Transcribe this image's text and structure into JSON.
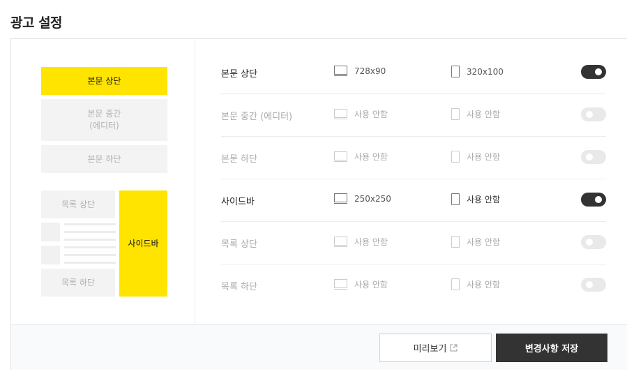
{
  "page": {
    "title": "광고 설정"
  },
  "preview": {
    "body_top": "본문 상단",
    "body_middle": "본문 중간\n(에디터)",
    "body_bottom": "본문 하단",
    "list_top": "목록 상단",
    "list_bottom": "목록 하단",
    "sidebar": "사이드바"
  },
  "rows": [
    {
      "label": "본문 상단",
      "pc": "728x90",
      "mobile": "320x100",
      "enabled": true
    },
    {
      "label": "본문 중간 (에디터)",
      "pc": "사용 안함",
      "mobile": "사용 안함",
      "enabled": false
    },
    {
      "label": "본문 하단",
      "pc": "사용 안함",
      "mobile": "사용 안함",
      "enabled": false
    },
    {
      "label": "사이드바",
      "pc": "250x250",
      "mobile": "사용 안함",
      "enabled": true
    },
    {
      "label": "목록 상단",
      "pc": "사용 안함",
      "mobile": "사용 안함",
      "enabled": false
    },
    {
      "label": "목록 하단",
      "pc": "사용 안함",
      "mobile": "사용 안함",
      "enabled": false
    }
  ],
  "footer": {
    "preview_label": "미리보기",
    "save_label": "변경사항 저장"
  },
  "colors": {
    "highlight": "#ffe400",
    "toggle_on": "#333333",
    "toggle_off": "#e9e9e9"
  }
}
